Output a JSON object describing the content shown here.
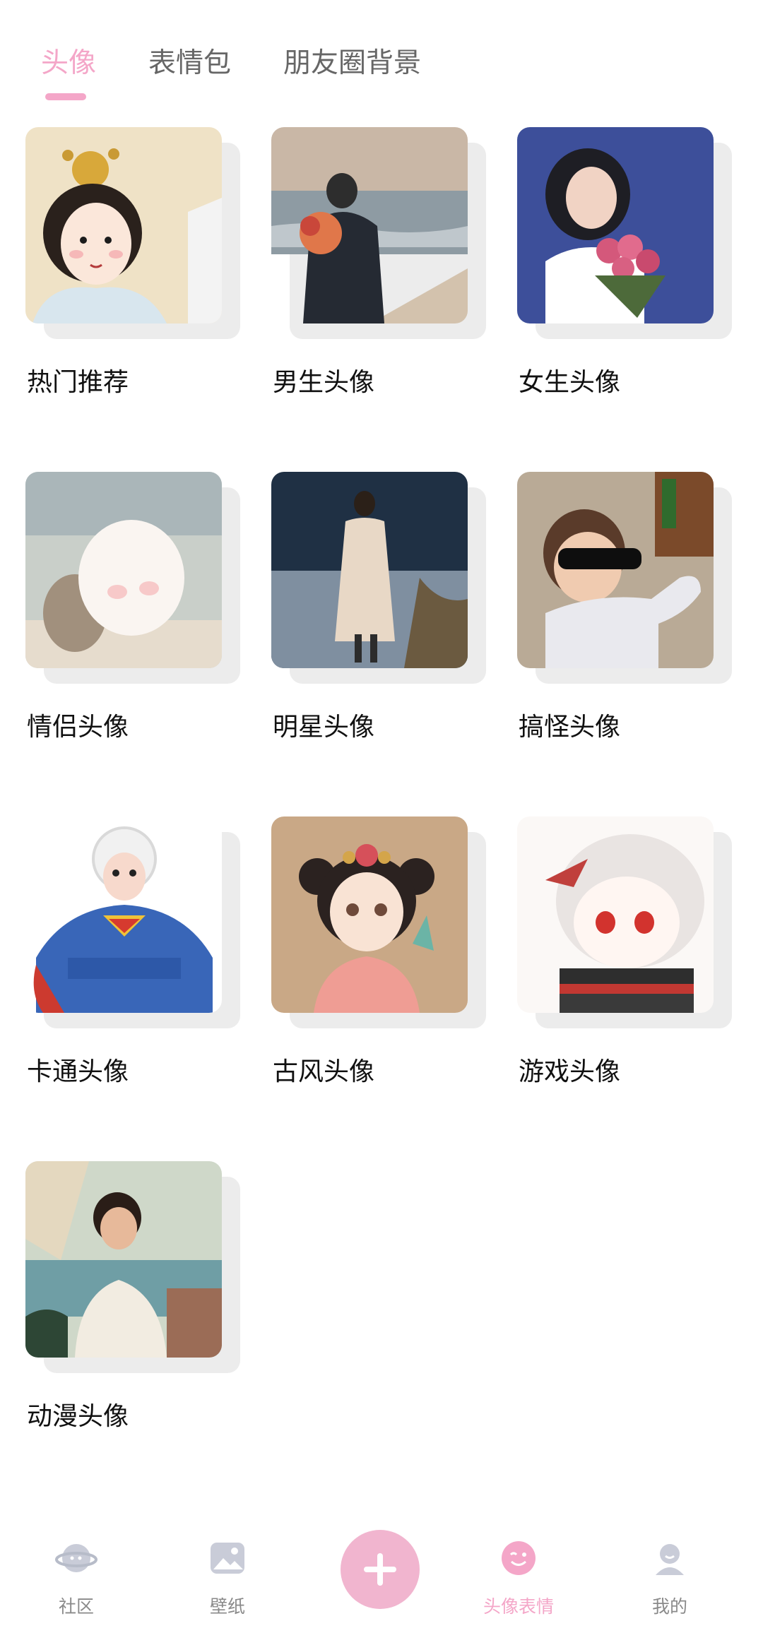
{
  "tabs": [
    {
      "label": "头像",
      "active": true
    },
    {
      "label": "表情包",
      "active": false
    },
    {
      "label": "朋友圈背景",
      "active": false
    }
  ],
  "categories": [
    {
      "label": "热门推荐"
    },
    {
      "label": "男生头像"
    },
    {
      "label": "女生头像"
    },
    {
      "label": "情侣头像"
    },
    {
      "label": "明星头像"
    },
    {
      "label": "搞怪头像"
    },
    {
      "label": "卡通头像"
    },
    {
      "label": "古风头像"
    },
    {
      "label": "游戏头像"
    },
    {
      "label": "动漫头像"
    }
  ],
  "bottom_nav": [
    {
      "label": "社区",
      "icon": "planet-icon",
      "active": false
    },
    {
      "label": "壁纸",
      "icon": "image-icon",
      "active": false
    },
    {
      "label": "头像表情",
      "icon": "wink-face-icon",
      "active": true
    },
    {
      "label": "我的",
      "icon": "profile-icon",
      "active": false
    }
  ],
  "fab": {
    "icon": "plus-icon"
  },
  "colors": {
    "accent": "#f4a6c8",
    "fab": "#f1b5cf",
    "inactive": "#8a8a8a"
  }
}
